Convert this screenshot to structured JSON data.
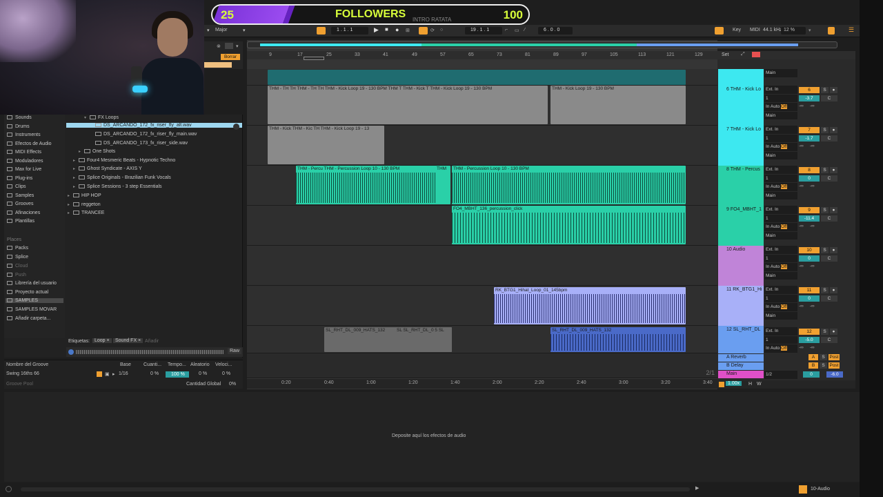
{
  "banner": {
    "left_value": "25",
    "title": "FOLLOWERS",
    "subtitle": "INTRO RATATA",
    "right_value": "100"
  },
  "topbar": {
    "scale": "Major",
    "position": "1 .   1 .   1",
    "loop_end": "19 .   1 .   1",
    "loop_length": "6 .   0 .   0",
    "key": "Key",
    "midi": "MIDI",
    "sample_rate": "44.1 kHz",
    "cpu": "12 %"
  },
  "browser": {
    "delete_label": "Borrar",
    "categories": [
      "Sounds",
      "Drums",
      "Instruments",
      "Efectos de Audio",
      "MIDI Effects",
      "Moduladores",
      "Max for Live",
      "Plug-ins",
      "Clips",
      "Samples",
      "Grooves",
      "Afinaciones",
      "Plantillas"
    ],
    "places_title": "Places",
    "places": [
      "Packs",
      "Splice",
      "Cloud",
      "Push",
      "Librería del usuario",
      "Proyecto actual",
      "SAMPLES",
      "SAMPLES MOVAR",
      "Añadir carpeta..."
    ],
    "files": [
      {
        "label": "FX Loops"
      },
      {
        "label": "DS_ARCANDO_172_fx_riser_fly_alt.wav"
      },
      {
        "label": "DS_ARCANDO_172_fx_riser_fly_main.wav"
      },
      {
        "label": "DS_ARCANDO_173_fx_riser_side.wav"
      },
      {
        "label": "One Shots"
      },
      {
        "label": "Four4 Mesmeric Beats - Hypnotic Techno"
      },
      {
        "label": "Ghost Syndicate - AXIS Y"
      },
      {
        "label": "Splice Originals - Brazilian Funk Vocals"
      },
      {
        "label": "Splice Sessions - 3 step Essentials"
      },
      {
        "label": "HIP HOP"
      },
      {
        "label": "reggeton"
      },
      {
        "label": "TRANCEE"
      }
    ],
    "tags_label": "Etiquetas:",
    "tags": [
      "Loop ×",
      "Sound FX ×"
    ],
    "add_tag": "Añadir",
    "raw": "Raw"
  },
  "groove": {
    "headers": [
      "Nombre del Groove",
      "Base",
      "Cuanti...",
      "Tempo...",
      "Aleatorio",
      "Veloci..."
    ],
    "row": {
      "name": "Swing 16ths 66",
      "base": "1/16",
      "quant": "0 %",
      "tempo": "100 %",
      "random": "0 %",
      "vel": "0 %"
    },
    "pool": "Groove Pool",
    "global": "Cantidad Global",
    "global_val": "0%"
  },
  "ruler": {
    "bars": [
      "9",
      "17",
      "25",
      "33",
      "41",
      "49",
      "57",
      "65",
      "73",
      "81",
      "89",
      "97",
      "105",
      "113",
      "121",
      "129"
    ],
    "times": [
      "0:20",
      "0:40",
      "1:00",
      "1:20",
      "1:40",
      "2:00",
      "2:20",
      "2:40",
      "3:00",
      "3:20",
      "3:40"
    ]
  },
  "clips": {
    "kick1": "THM - TH TH THM - TH TH THM - Kick Loop 19 - 130 BPM THM T THM - Kick T THM - Kick Loop 19 - 130 BPM",
    "kick1b": "THM - Kick Loop 19 - 130 BPM",
    "kick2": "THM - Kick   THM - Kic TH THM - Kick Loop 19 - 13",
    "perc1": "THM - Percu THM - Percussion Loop 10 - 130 BPM",
    "perc_mid": "THM",
    "perc2": "THM - Percussion Loop 10 - 130 BPM",
    "fo4": "FO4_MBHT_136_percussion_click",
    "hihat": "RK_BTG1_Hihat_Loop_01_145bpm",
    "sl1": "SL_RHT_DL_009_HATS_132",
    "sl_mid": "SL  SL_RHT_DL_0 5 SL",
    "sl2": "SL_RHT_DL_009_HATS_132"
  },
  "tracks": [
    {
      "name": "6 THM - Kick Lo",
      "num": "6",
      "vol": "-3.7",
      "color": "#3de8f0"
    },
    {
      "name": "7 THM - Kick Lo",
      "num": "7",
      "vol": "-1.7",
      "color": "#3de8f0"
    },
    {
      "name": "8 THM - Percus",
      "num": "8",
      "vol": "0",
      "color": "#2ad0a8"
    },
    {
      "name": "9 FO4_MBHT_1",
      "num": "9",
      "vol": "-11.4",
      "color": "#2ad0a8"
    },
    {
      "name": "10 Audio",
      "num": "10",
      "vol": "0",
      "color": "#c084d8"
    },
    {
      "name": "11 RK_BTG1_Hi",
      "num": "11",
      "vol": "0",
      "color": "#a8b0f8"
    },
    {
      "name": "12 SL_RHT_DL",
      "num": "12",
      "vol": "-5.0",
      "color": "#6a9ef0"
    }
  ],
  "io_labels": {
    "in": "Ext. In",
    "ch": "1",
    "main": "Main",
    "mode_in": "In",
    "auto": "Auto",
    "off": "Off",
    "inf": "-∞",
    "c": "C",
    "s": "S"
  },
  "returns": [
    {
      "name": "A Reverb",
      "key": "A",
      "post": "Post"
    },
    {
      "name": "B Delay",
      "key": "B",
      "post": "Post"
    },
    {
      "name": "Main",
      "key": "",
      "post": ""
    }
  ],
  "main_ratio": "1/2",
  "main_vol": "-6.0",
  "set_label": "Set",
  "page_indicator": "2/1",
  "zoom_label": "1.00x",
  "devices_hint": "Deposite aquí los efectos de audio",
  "status": "10-Audio",
  "colors": {
    "accent": "#f0a030",
    "cyan": "#3de8f0",
    "teal": "#2ad0a8",
    "violet": "#a8b0f8",
    "blue": "#6a9ef0"
  }
}
